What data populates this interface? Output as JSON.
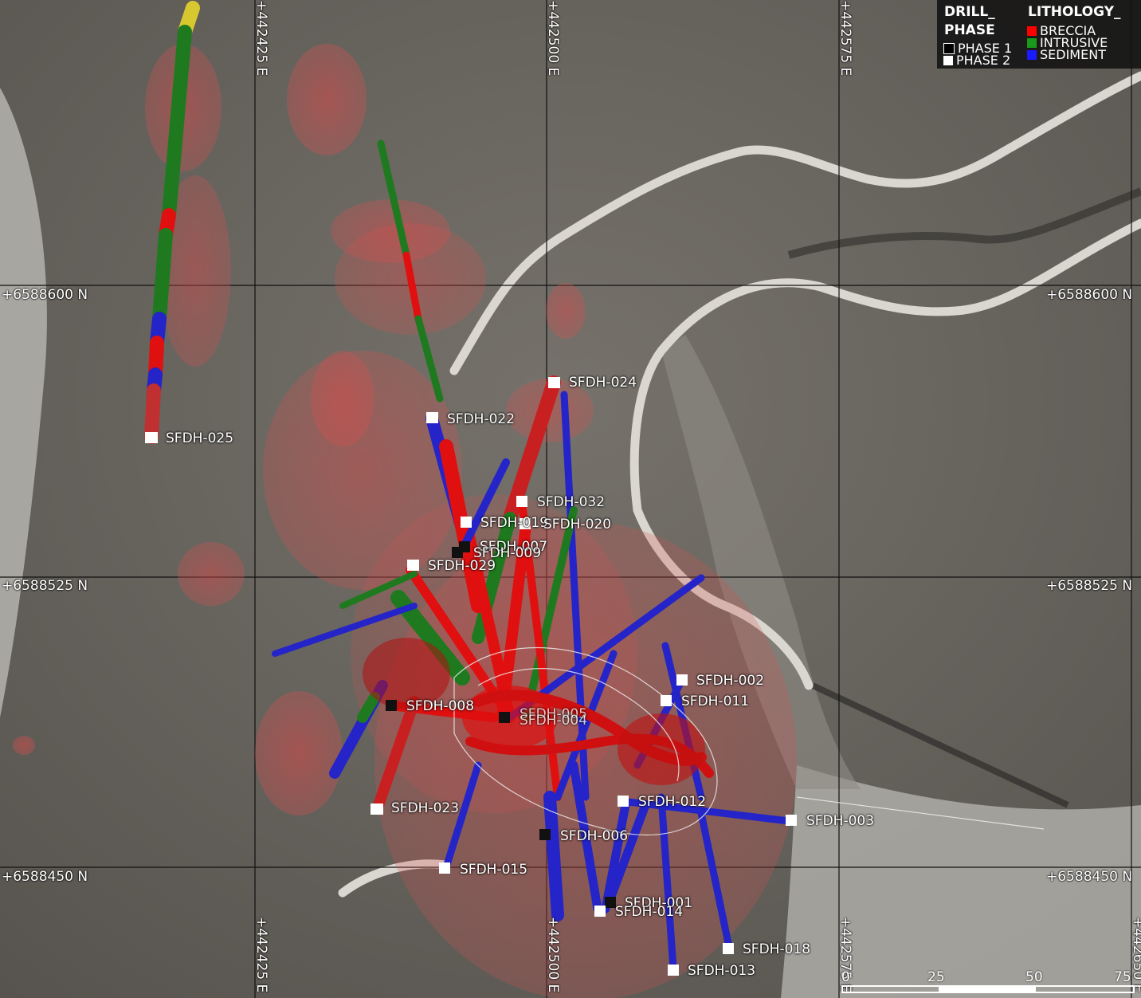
{
  "grid": {
    "easting_labels": [
      "+442425 E",
      "+442500 E",
      "+442575 E",
      "+442650 E"
    ],
    "northing_labels": [
      "+6588600 N",
      "+6588525 N",
      "+6588450 N"
    ]
  },
  "legend": {
    "drill_phase_title": "DRILL_\nPHASE",
    "drill_phase_line1": "DRILL_",
    "drill_phase_line2": "PHASE",
    "phases": [
      {
        "label": "PHASE 1",
        "color": "#000000"
      },
      {
        "label": "PHASE 2",
        "color": "#ffffff"
      }
    ],
    "lithology_title": "LITHOLOGY_",
    "lithology": [
      {
        "label": "BRECCIA",
        "color": "#ff0000"
      },
      {
        "label": "INTRUSIVE",
        "color": "#1a9a1a"
      },
      {
        "label": "SEDIMENT",
        "color": "#1a1aff"
      }
    ]
  },
  "drill_holes": [
    "SFDH-025",
    "SFDH-024",
    "SFDH-022",
    "SFDH-032",
    "SFDH-019",
    "SFDH-020",
    "SFDH-007",
    "SFDH-009",
    "SFDH-029",
    "SFDH-008",
    "SFDH-005",
    "SFDH-004",
    "SFDH-002",
    "SFDH-011",
    "SFDH-023",
    "SFDH-012",
    "SFDH-003",
    "SFDH-006",
    "SFDH-015",
    "SFDH-001",
    "SFDH-014",
    "SFDH-018",
    "SFDH-013"
  ],
  "hole_phase": {
    "SFDH-025": 2,
    "SFDH-024": 2,
    "SFDH-022": 2,
    "SFDH-032": 2,
    "SFDH-019": 2,
    "SFDH-020": 2,
    "SFDH-007": 1,
    "SFDH-009": 1,
    "SFDH-029": 2,
    "SFDH-008": 1,
    "SFDH-005": 1,
    "SFDH-004": 1,
    "SFDH-002": 2,
    "SFDH-011": 2,
    "SFDH-023": 2,
    "SFDH-012": 2,
    "SFDH-003": 2,
    "SFDH-006": 1,
    "SFDH-015": 2,
    "SFDH-001": 1,
    "SFDH-014": 2,
    "SFDH-018": 2,
    "SFDH-013": 2
  },
  "scale_bar": {
    "ticks": [
      "0",
      "25",
      "50",
      "75"
    ]
  },
  "colors": {
    "breccia": "#e01010",
    "intrusive": "#1f7a1f",
    "sediment": "#2424c8",
    "anomaly": "#e05a5a",
    "road": "#d8d6cf",
    "grid": "#111111"
  }
}
